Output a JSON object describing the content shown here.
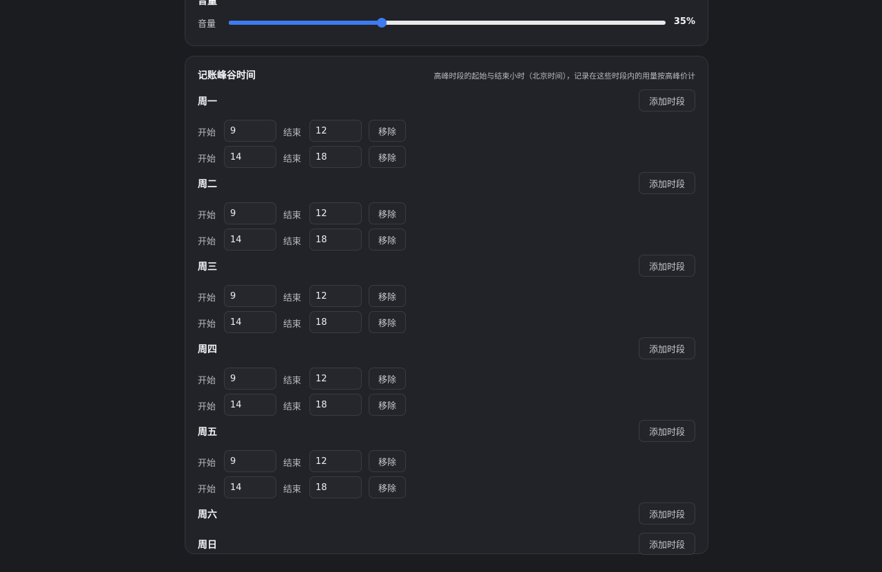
{
  "volume": {
    "title": "音量",
    "label": "音量",
    "value_text": "35%",
    "level_percent": 35,
    "accent": "#3d7bf0"
  },
  "peak": {
    "title": "记账峰谷时间",
    "hint": "高峰时段的起始与结束小时（北京时间），记录在这些时段内的用量按高峰价计",
    "add_label": "添加时段",
    "start_label": "开始",
    "end_label": "结束",
    "remove_label": "移除",
    "days": [
      {
        "name": "周一",
        "slots": [
          {
            "start": "9",
            "end": "12"
          },
          {
            "start": "14",
            "end": "18"
          }
        ]
      },
      {
        "name": "周二",
        "slots": [
          {
            "start": "9",
            "end": "12"
          },
          {
            "start": "14",
            "end": "18"
          }
        ]
      },
      {
        "name": "周三",
        "slots": [
          {
            "start": "9",
            "end": "12"
          },
          {
            "start": "14",
            "end": "18"
          }
        ]
      },
      {
        "name": "周四",
        "slots": [
          {
            "start": "9",
            "end": "12"
          },
          {
            "start": "14",
            "end": "18"
          }
        ]
      },
      {
        "name": "周五",
        "slots": [
          {
            "start": "9",
            "end": "12"
          },
          {
            "start": "14",
            "end": "18"
          }
        ]
      },
      {
        "name": "周六",
        "slots": []
      },
      {
        "name": "周日",
        "slots": []
      }
    ]
  }
}
